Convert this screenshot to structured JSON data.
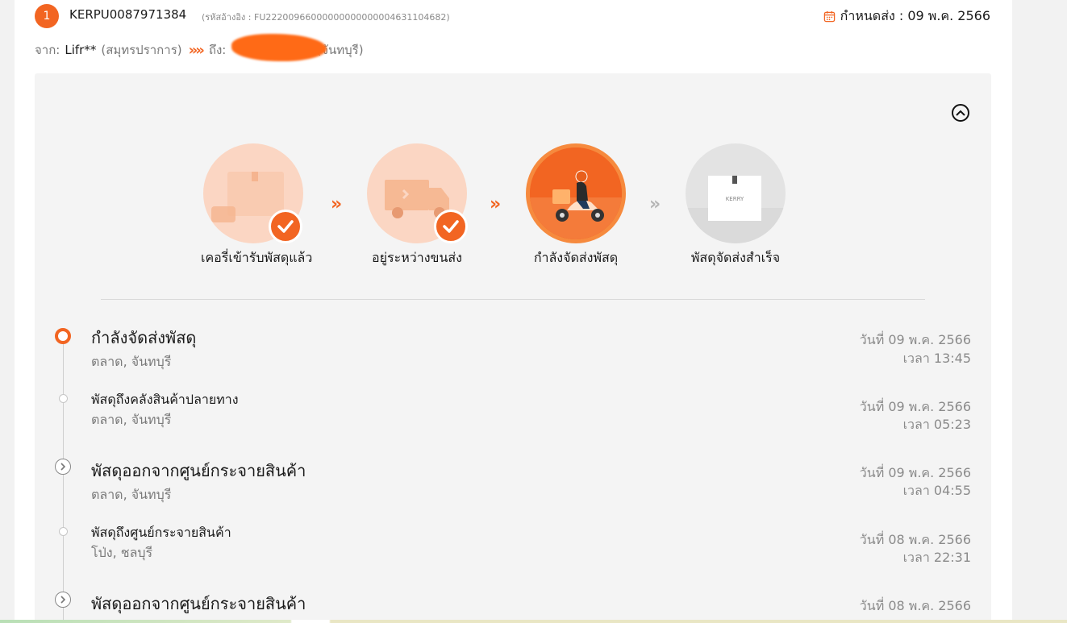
{
  "order": {
    "index": "1",
    "tracking_number": "KERPU0087971384",
    "reference": "(รหัสอ้างอิง : FU22200966000000000000004631104682)",
    "due_label": "กำหนดส่ง : 09 พ.ค. 2566"
  },
  "route": {
    "from_label": "จาก:",
    "sender": "Lifr**",
    "from_province": "(สมุทรปราการ)",
    "arrow": "»",
    "to_label": "ถึง:",
    "to_province": "(จันทบุรี)"
  },
  "steps": [
    {
      "label": "เคอรี่เข้ารับพัสดุแล้ว",
      "state": "done"
    },
    {
      "label": "อยู่ระหว่างขนส่ง",
      "state": "done"
    },
    {
      "label": "กำลังจัดส่งพัสดุ",
      "state": "active"
    },
    {
      "label": "พัสดุจัดส่งสำเร็จ",
      "state": "pending"
    }
  ],
  "chevron": "»",
  "brand_text": "KERRY",
  "events": [
    {
      "title": "กำลังจัดส่งพัสดุ",
      "location": "ตลาด, จันทบุรี",
      "date": "วันที่ 09 พ.ค. 2566",
      "time": "เวลา 13:45"
    },
    {
      "title": "พัสดุถึงคลังสินค้าปลายทาง",
      "location": "ตลาด, จันทบุรี",
      "date": "วันที่ 09 พ.ค. 2566",
      "time": "เวลา 05:23"
    },
    {
      "title": "พัสดุออกจากศูนย์กระจายสินค้า",
      "location": "ตลาด, จันทบุรี",
      "date": "วันที่ 09 พ.ค. 2566",
      "time": "เวลา 04:55"
    },
    {
      "title": "พัสดุถึงศูนย์กระจายสินค้า",
      "location": "โป่ง, ชลบุรี",
      "date": "วันที่ 08 พ.ค. 2566",
      "time": "เวลา 22:31"
    },
    {
      "title": "พัสดุออกจากศูนย์กระจายสินค้า",
      "location": "",
      "date": "วันที่ 08 พ.ค. 2566",
      "time": ""
    }
  ],
  "colors": {
    "accent": "#f26522",
    "accent_light": "#fbd6c3",
    "muted": "#8a8a8a",
    "panel": "#f4f4f4"
  },
  "icons": [
    "calendar-icon",
    "chevron-up-icon",
    "check-icon",
    "delivery-scooter-icon",
    "truck-icon",
    "parcel-box-icon",
    "chevron-right-icon"
  ]
}
